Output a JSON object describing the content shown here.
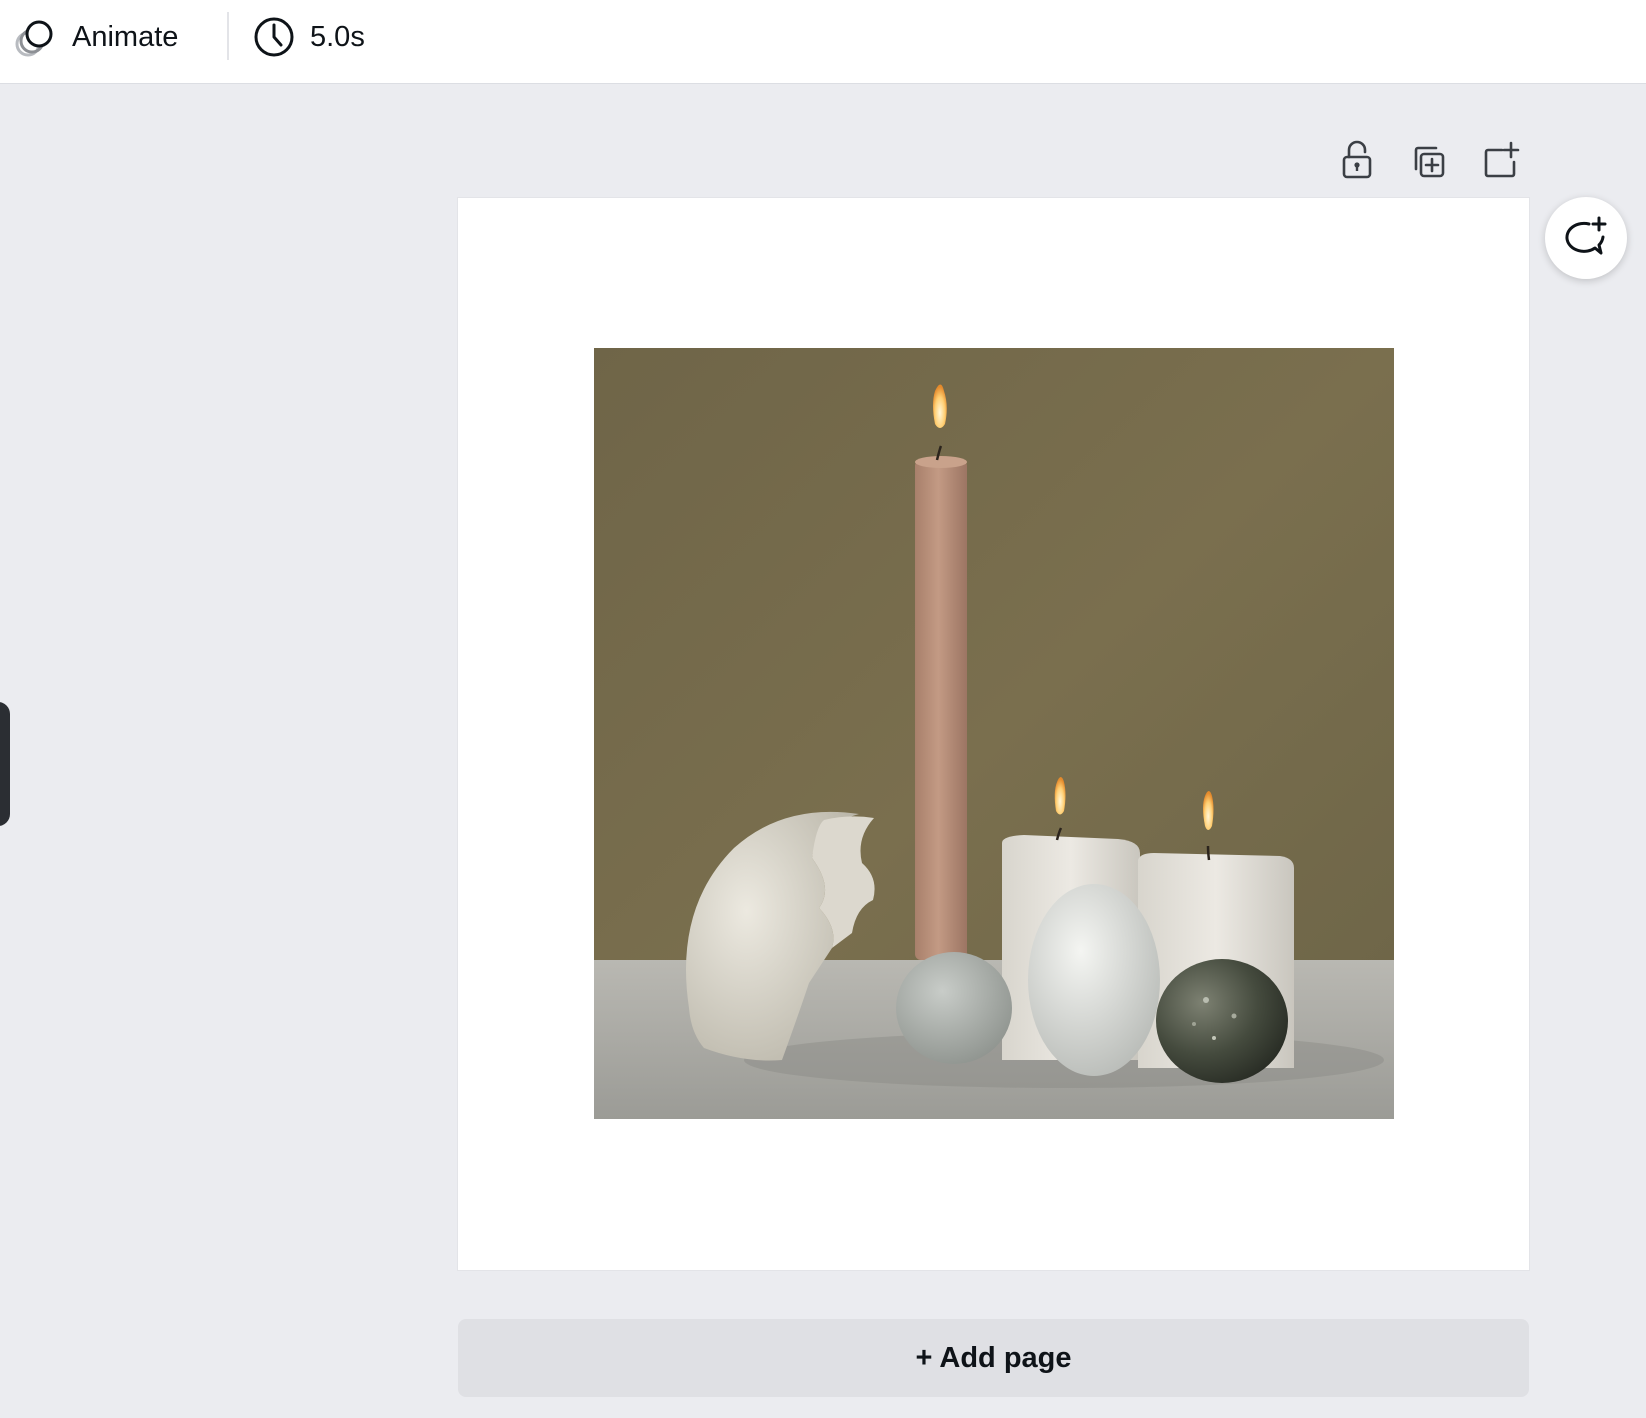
{
  "toolbar": {
    "animate_label": "Animate",
    "animate_icon": "animate-circles-icon",
    "duration_label": "5.0s",
    "duration_icon": "clock-icon"
  },
  "page_actions": {
    "lock_icon": "lock-icon",
    "duplicate_icon": "duplicate-page-icon",
    "add_icon": "add-page-icon"
  },
  "comment": {
    "icon": "add-comment-icon"
  },
  "canvas": {
    "image_subject": "candles-and-eggs-photo"
  },
  "add_page": {
    "label": "+ Add page"
  },
  "colors": {
    "workspace_bg": "#ebecf0",
    "toolbar_bg": "#ffffff",
    "button_bg": "#dfe0e4",
    "text": "#0e1318"
  }
}
